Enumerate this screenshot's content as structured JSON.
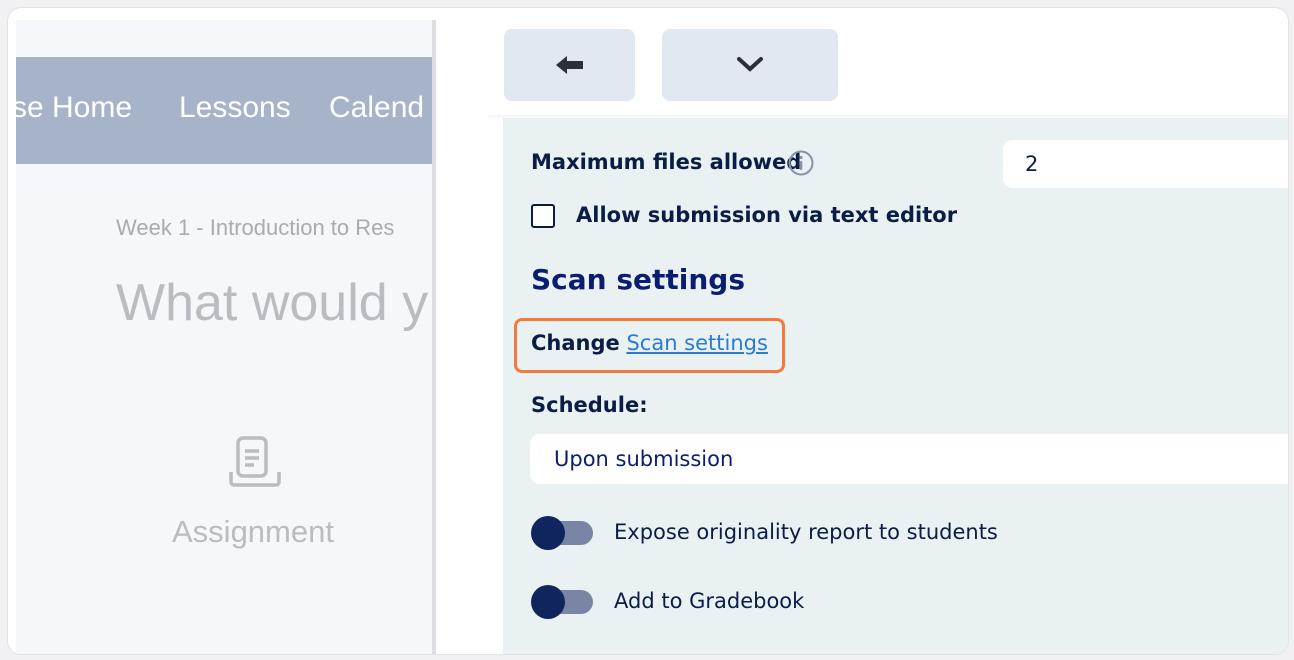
{
  "course": {
    "nav_items": [
      "se Home",
      "Lessons",
      "Calend"
    ],
    "breadcrumb": "Week 1 - Introduction to Res",
    "heading": "What would y",
    "item_label": "Assignment"
  },
  "toolbar": {
    "back_icon": "arrow-left-icon",
    "expand_icon": "chevron-down-icon"
  },
  "form": {
    "max_files_label": "Maximum files allowed",
    "max_files_value": "2",
    "text_editor_label": "Allow submission via text editor",
    "text_editor_checked": false,
    "scan_section_title": "Scan settings",
    "change_prefix": "Change",
    "scan_link": "Scan settings",
    "schedule_label": "Schedule:",
    "schedule_value": "Upon submission",
    "toggles": [
      {
        "label": "Expose originality report to students",
        "on": false
      },
      {
        "label": "Add to Gradebook",
        "on": false
      }
    ]
  },
  "colors": {
    "nav_bar": "#a7b3c9",
    "highlight": "#f47a3c",
    "link": "#2a7ad8",
    "toggle_knob": "#10245e"
  }
}
